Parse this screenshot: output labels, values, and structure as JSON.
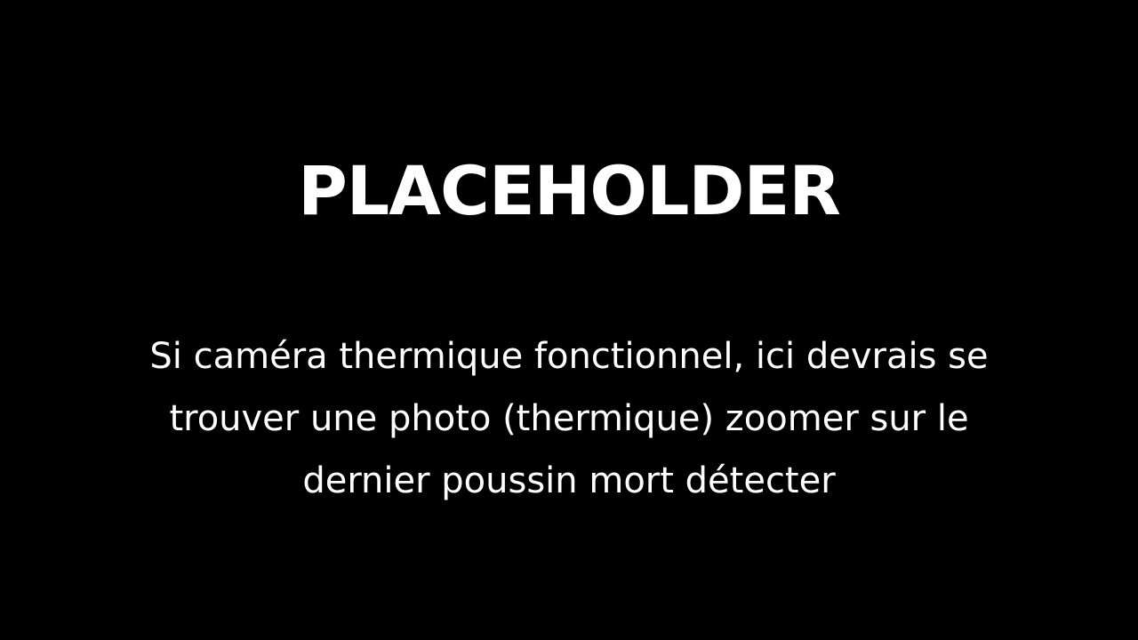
{
  "slide": {
    "title": "PLACEHOLDER",
    "body_lines": [
      "Si caméra thermique fonctionnel, ici devrais se",
      "trouver une photo (thermique) zoomer sur le",
      "dernier poussin mort détecter"
    ]
  },
  "colors": {
    "background": "#000000",
    "text": "#ffffff"
  }
}
